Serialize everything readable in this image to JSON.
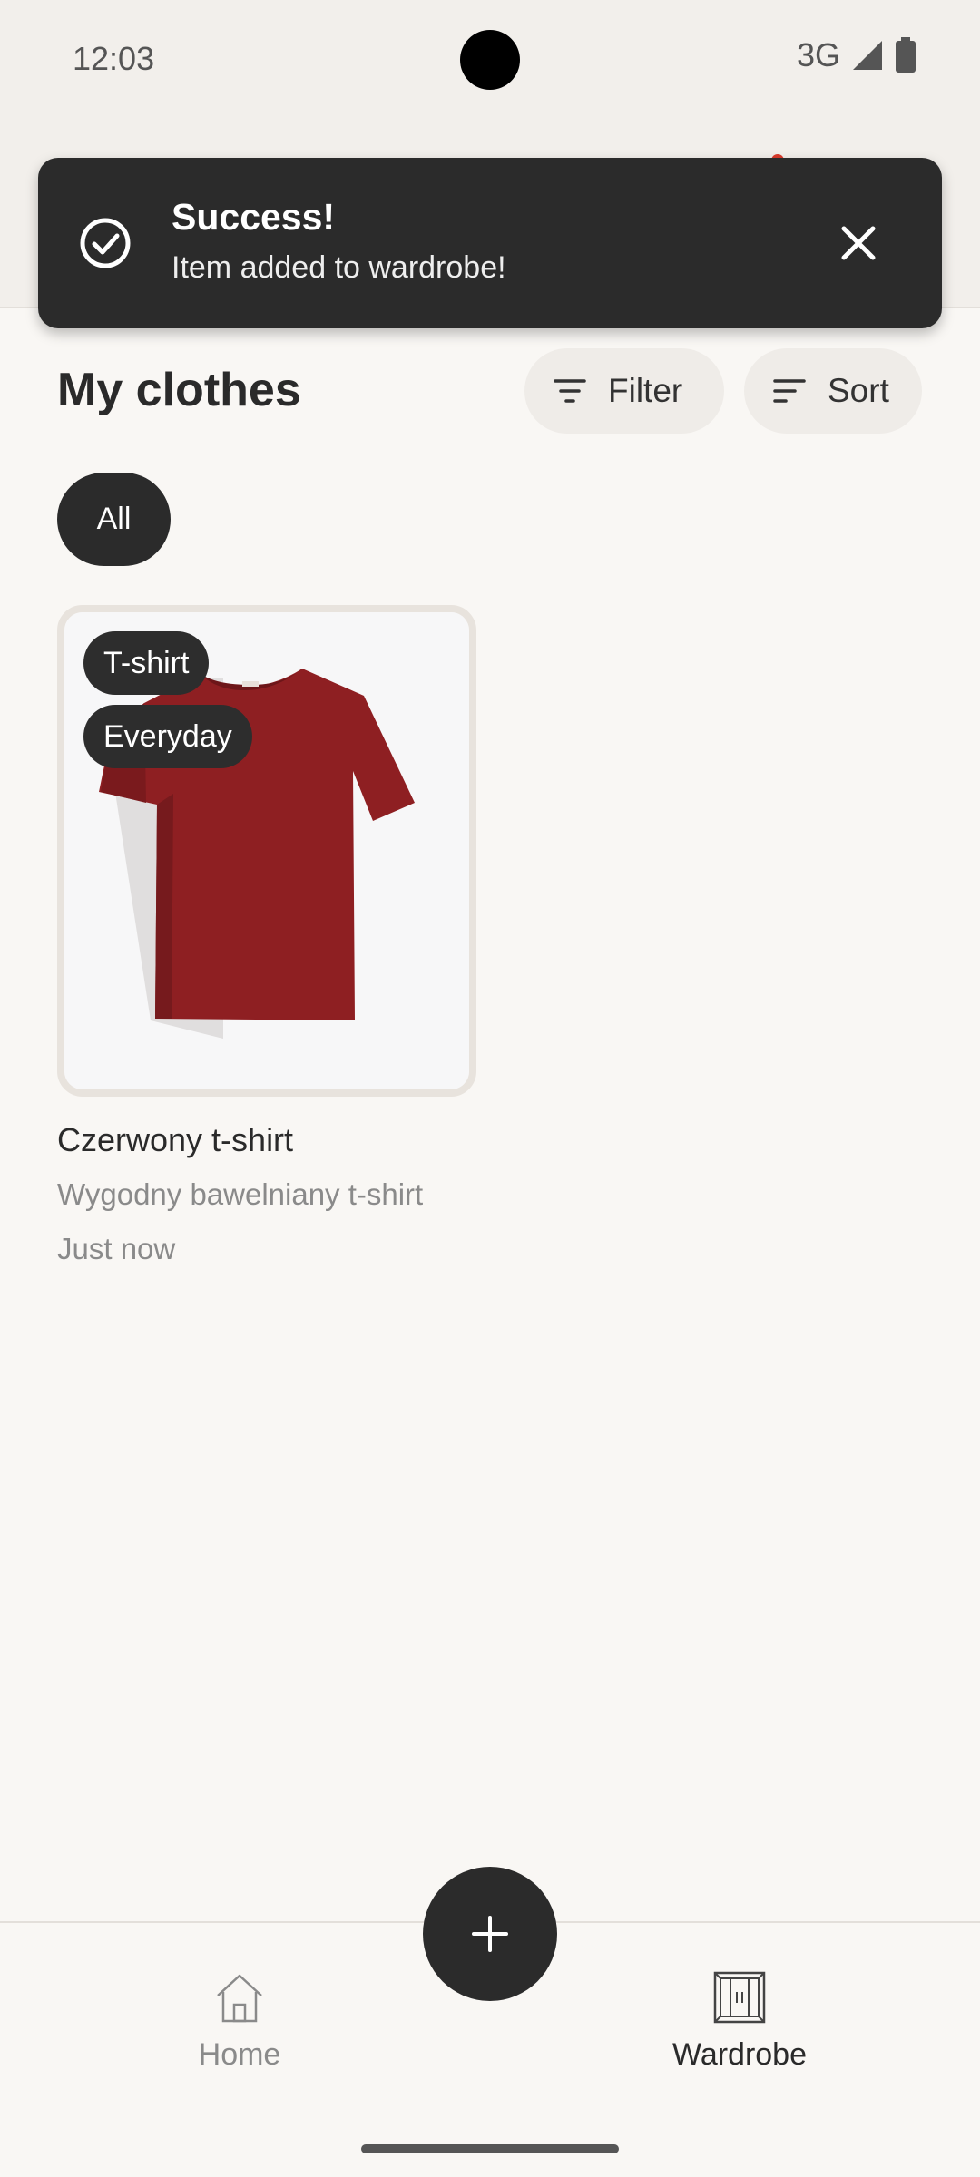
{
  "status_bar": {
    "time": "12:03",
    "network": "3G"
  },
  "snackbar": {
    "title": "Success!",
    "message": "Item added to wardrobe!"
  },
  "main": {
    "title": "My clothes",
    "filter_label": "Filter",
    "sort_label": "Sort",
    "chips": [
      {
        "label": "All",
        "selected": true
      }
    ]
  },
  "items": [
    {
      "tags": [
        "T-shirt",
        "Everyday"
      ],
      "name": "Czerwony t-shirt",
      "description": "Wygodny bawelniany t-shirt",
      "added": "Just now",
      "color": "#8e1f22"
    }
  ],
  "bottom_nav": {
    "items": [
      {
        "label": "Home",
        "icon": "house-icon",
        "active": false
      },
      {
        "label": "Wardrobe",
        "icon": "wardrobe-icon",
        "active": true
      }
    ],
    "fab_icon": "plus-icon"
  },
  "colors": {
    "accent": "#2b2b2b",
    "background": "#f9f7f4",
    "notification_dot": "#d93a2b"
  }
}
